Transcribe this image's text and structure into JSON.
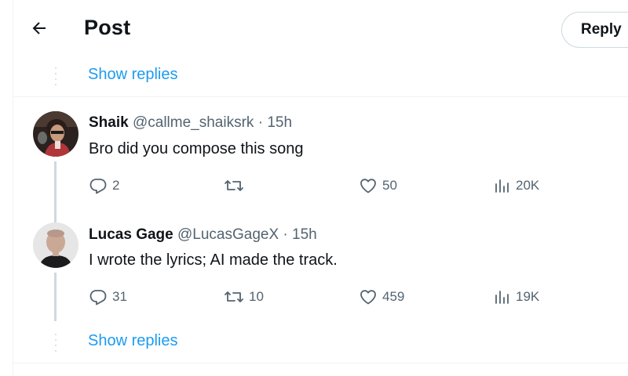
{
  "header": {
    "title": "Post",
    "reply_button": "Reply"
  },
  "show_replies_top": "Show replies",
  "show_replies_bottom": "Show replies",
  "tweets": [
    {
      "name": "Shaik",
      "handle": "@callme_shaiksrk",
      "separator": "·",
      "time": "15h",
      "text": "Bro did you compose this song",
      "replies": "2",
      "reposts": "",
      "likes": "50",
      "views": "20K"
    },
    {
      "name": "Lucas Gage",
      "handle": "@LucasGageX",
      "separator": "·",
      "time": "15h",
      "text": "I wrote the lyrics; AI made the track.",
      "replies": "31",
      "reposts": "10",
      "likes": "459",
      "views": "19K"
    }
  ],
  "colors": {
    "accent": "#1d9bf0",
    "text": "#0f1419",
    "secondary": "#536471",
    "border": "#eff3f4",
    "thread": "#cfd9de"
  },
  "icons": [
    "back-arrow-icon",
    "reply-icon",
    "repost-icon",
    "like-icon",
    "views-icon"
  ]
}
